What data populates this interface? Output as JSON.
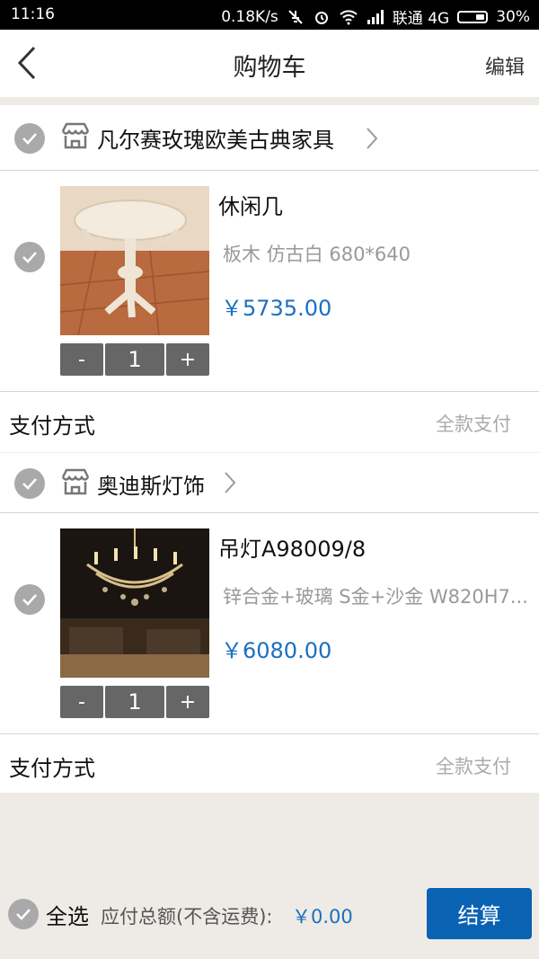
{
  "status_bar": {
    "time": "11:16",
    "speed": "0.18K/s",
    "carrier": "联通 4G",
    "battery": "30%"
  },
  "header": {
    "title": "购物车",
    "edit_label": "编辑"
  },
  "stores": [
    {
      "name": "凡尔赛玫瑰欧美古典家具",
      "product": {
        "name": "休闲几",
        "spec": "板木 仿古白 680*640",
        "price": "￥5735.00",
        "quantity": "1",
        "minus": "-",
        "plus": "+"
      },
      "payment": {
        "label": "支付方式",
        "value": "全款支付"
      }
    },
    {
      "name": "奥迪斯灯饰",
      "product": {
        "name": "吊灯A98009/8",
        "spec": "锌合金+玻璃 S金+沙金 W820H7...",
        "price": "￥6080.00",
        "quantity": "1",
        "minus": "-",
        "plus": "+"
      },
      "payment": {
        "label": "支付方式",
        "value": "全款支付"
      }
    }
  ],
  "footer": {
    "select_all": "全选",
    "total_label": "应付总额(不含运费):",
    "total_value": "￥0.00",
    "checkout_label": "结算"
  },
  "colors": {
    "accent": "#0a62b3",
    "price": "#1b6fc0",
    "background": "#eeebe6"
  }
}
